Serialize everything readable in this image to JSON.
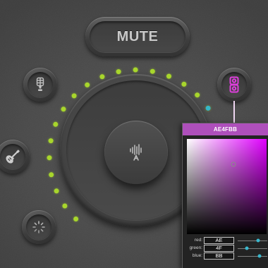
{
  "mute_button": {
    "label": "MUTE"
  },
  "input_buttons": [
    {
      "icon": "microphone-icon"
    },
    {
      "icon": "guitar-icon"
    },
    {
      "icon": "dotted-circle-icon"
    }
  ],
  "link_button": {
    "icon": "linked-channels-icon",
    "color": "#de3fdc"
  },
  "main_knob": {
    "icon": "waveform-icon",
    "level_leds_lit": 17,
    "led_on_color": "#a8d62c",
    "marker_led_color": "#35b7c8"
  },
  "connector_color": "#efd6f1",
  "color_picker": {
    "hex": "AE4FBB",
    "selected_color": "#ae4fbb",
    "hue_color": "#e000ff",
    "saturation": 0.58,
    "brightness": 0.73,
    "slider_knob_color": "#3ab8cd",
    "channels": [
      {
        "label": "red:",
        "value": "AE",
        "level": 0.68
      },
      {
        "label": "green:",
        "value": "4F",
        "level": 0.31
      },
      {
        "label": "blue:",
        "value": "BB",
        "level": 0.73
      }
    ]
  }
}
